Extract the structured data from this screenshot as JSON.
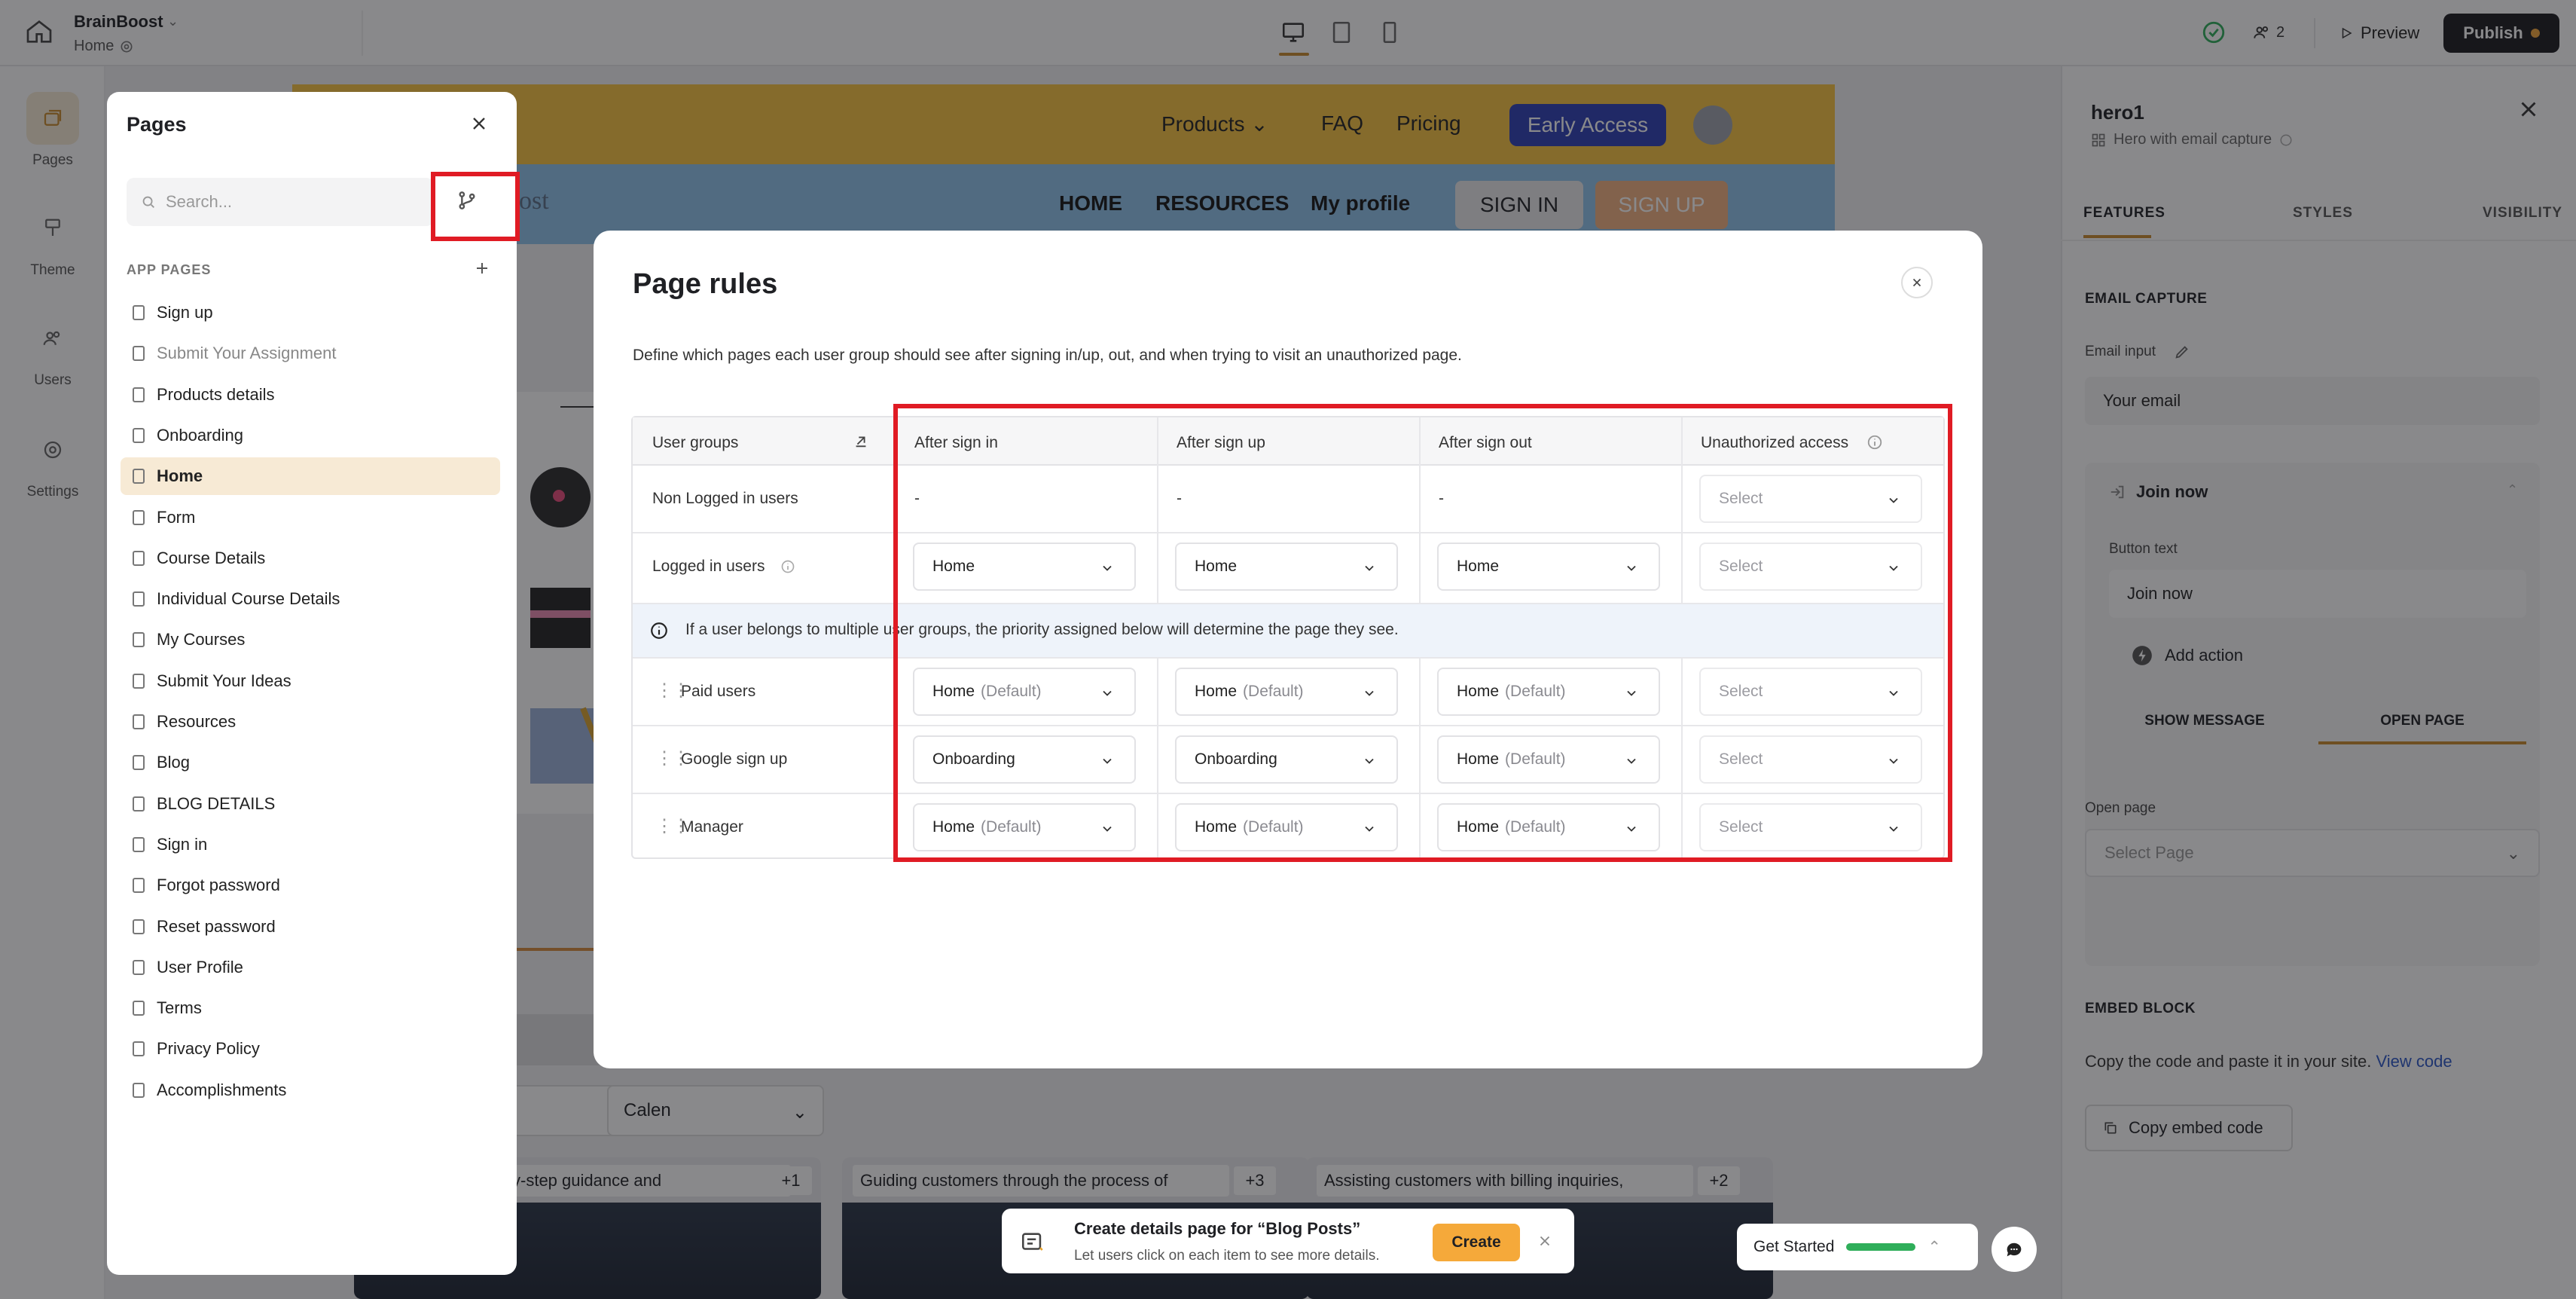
{
  "topbar": {
    "project_name": "BrainBoost",
    "current_page": "Home",
    "collaborators_count": "2",
    "preview_label": "Preview",
    "publish_label": "Publish"
  },
  "rail": {
    "pages": "Pages",
    "theme": "Theme",
    "users": "Users",
    "settings": "Settings"
  },
  "site": {
    "nav_products": "Products",
    "nav_faq": "FAQ",
    "nav_pricing": "Pricing",
    "early_access": "Early Access",
    "logo_fragment": "oost",
    "sub_home": "HOME",
    "sub_resources": "RESOURCES",
    "sub_profile": "My profile",
    "sign_in": "SIGN IN",
    "sign_up": "SIGN UP",
    "filter_2": "Calen",
    "cards": [
      {
        "text": "y-step guidance and",
        "badge": "+1"
      },
      {
        "text": "Guiding customers through the process of",
        "badge": "+3"
      },
      {
        "text": "Assisting customers with billing inquiries,",
        "badge": "+2"
      }
    ]
  },
  "pages_panel": {
    "title": "Pages",
    "search_placeholder": "Search...",
    "section": "APP PAGES",
    "items": [
      {
        "label": "Sign up"
      },
      {
        "label": "Submit Your Assignment"
      },
      {
        "label": "Products details"
      },
      {
        "label": "Onboarding"
      },
      {
        "label": "Home"
      },
      {
        "label": "Form"
      },
      {
        "label": "Course Details"
      },
      {
        "label": "Individual Course Details"
      },
      {
        "label": "My Courses"
      },
      {
        "label": "Submit Your Ideas"
      },
      {
        "label": "Resources"
      },
      {
        "label": "Blog"
      },
      {
        "label": "BLOG DETAILS"
      },
      {
        "label": "Sign in"
      },
      {
        "label": "Forgot password"
      },
      {
        "label": "Reset password"
      },
      {
        "label": "User Profile"
      },
      {
        "label": "Terms"
      },
      {
        "label": "Privacy Policy"
      },
      {
        "label": "Accomplishments"
      }
    ]
  },
  "modal": {
    "title": "Page rules",
    "description": "Define which pages each user group should see after signing in/up, out, and when trying to visit an unauthorized page.",
    "columns": {
      "user_groups": "User groups",
      "after_sign_in": "After sign in",
      "after_sign_up": "After sign up",
      "after_sign_out": "After sign out",
      "unauthorized": "Unauthorized access"
    },
    "priority_note": "If a user belongs to multiple user groups, the priority assigned below will determine the page they see.",
    "default_suffix": "(Default)",
    "select_placeholder": "Select",
    "dash": "-",
    "rows": [
      {
        "group": "Non Logged in users"
      },
      {
        "group": "Logged in users",
        "sign_in": "Home",
        "sign_up": "Home",
        "sign_out": "Home"
      },
      {
        "group": "Paid users",
        "sign_in": "Home",
        "sign_up": "Home",
        "sign_out": "Home"
      },
      {
        "group": "Google sign up",
        "sign_in": "Onboarding",
        "sign_up": "Onboarding",
        "sign_out": "Home"
      },
      {
        "group": "Manager",
        "sign_in": "Home",
        "sign_up": "Home",
        "sign_out": "Home"
      }
    ]
  },
  "inspector": {
    "title": "hero1",
    "subtitle": "Hero with email capture",
    "tabs": [
      "FEATURES",
      "STYLES",
      "VISIBILITY"
    ],
    "email_capture": "EMAIL CAPTURE",
    "email_input_label": "Email input",
    "email_input_value": "Your email",
    "join_now": "Join now",
    "button_text_label": "Button text",
    "button_text_value": "Join now",
    "add_action": "Add action",
    "show_message": "SHOW MESSAGE",
    "open_page": "OPEN PAGE",
    "open_page_label": "Open page",
    "select_page": "Select Page",
    "embed_block": "EMBED BLOCK",
    "embed_desc": "Copy the code and paste it in your site.",
    "view_code": "View code",
    "copy_embed": "Copy embed code"
  },
  "toast": {
    "title": "Create details page for “Blog Posts”",
    "subtitle": "Let users click on each item to see more details.",
    "create": "Create"
  },
  "get_started": "Get Started"
}
